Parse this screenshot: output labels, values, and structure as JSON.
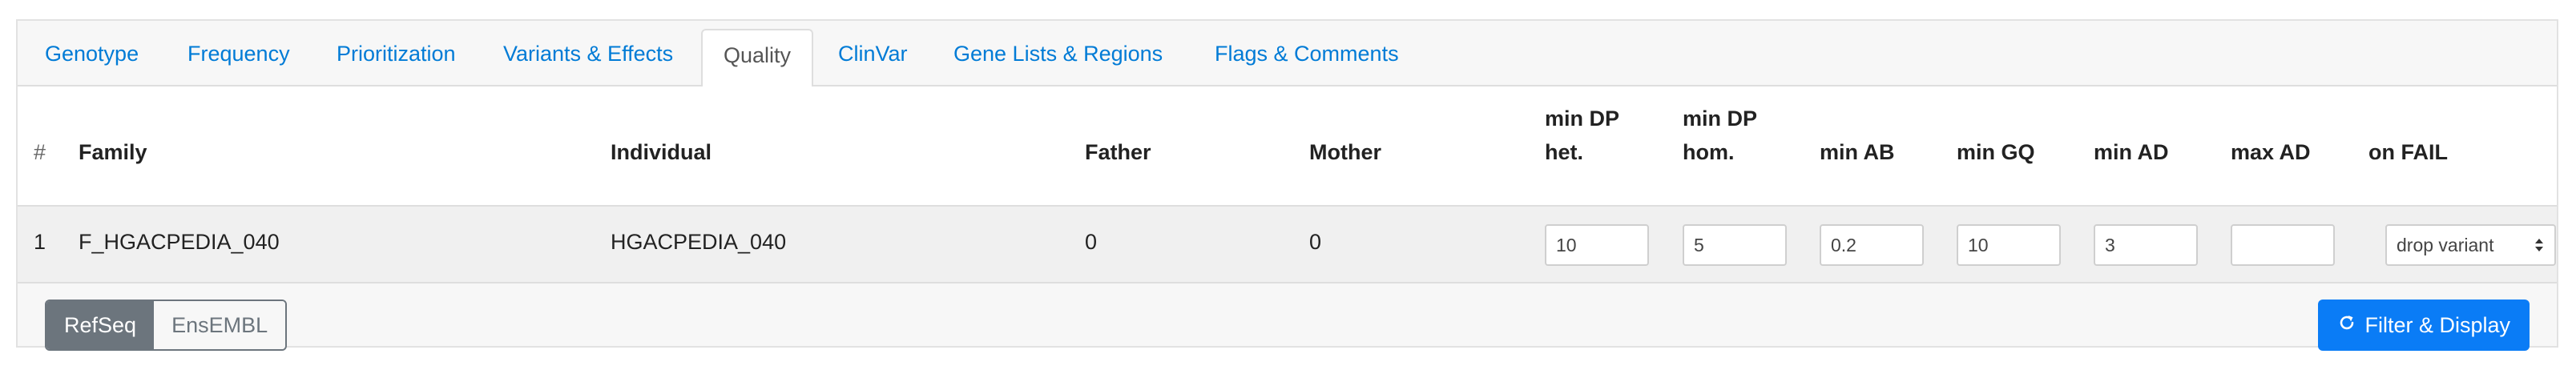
{
  "tabs": [
    {
      "label": "Genotype"
    },
    {
      "label": "Frequency"
    },
    {
      "label": "Prioritization"
    },
    {
      "label": "Variants & Effects"
    },
    {
      "label": "Quality"
    },
    {
      "label": "ClinVar"
    },
    {
      "label": "Gene Lists & Regions"
    },
    {
      "label": "Flags & Comments"
    }
  ],
  "active_tab": "Quality",
  "table": {
    "headers": {
      "hash": "#",
      "family": "Family",
      "individual": "Individual",
      "father": "Father",
      "mother": "Mother",
      "min_dp_het_1": "min DP",
      "min_dp_het_2": "het.",
      "min_dp_hom_1": "min DP",
      "min_dp_hom_2": "hom.",
      "min_ab": "min AB",
      "min_gq": "min GQ",
      "min_ad": "min AD",
      "max_ad": "max AD",
      "on_fail": "on FAIL"
    },
    "rows": [
      {
        "index": "1",
        "family": "F_HGACPEDIA_040",
        "individual": "HGACPEDIA_040",
        "father": "0",
        "mother": "0",
        "min_dp_het": "10",
        "min_dp_hom": "5",
        "min_ab": "0.2",
        "min_gq": "10",
        "min_ad": "3",
        "max_ad": "",
        "on_fail": "drop variant"
      }
    ]
  },
  "footer": {
    "refseq_label": "RefSeq",
    "ensembl_label": "EnsEMBL",
    "selected_db": "RefSeq",
    "filter_label": "Filter & Display"
  },
  "colors": {
    "link": "#007bd6",
    "primary": "#0a7cf6",
    "secondary": "#6c757d"
  },
  "icons": {
    "filter": "refresh-icon",
    "select": "sort-arrows-icon"
  }
}
